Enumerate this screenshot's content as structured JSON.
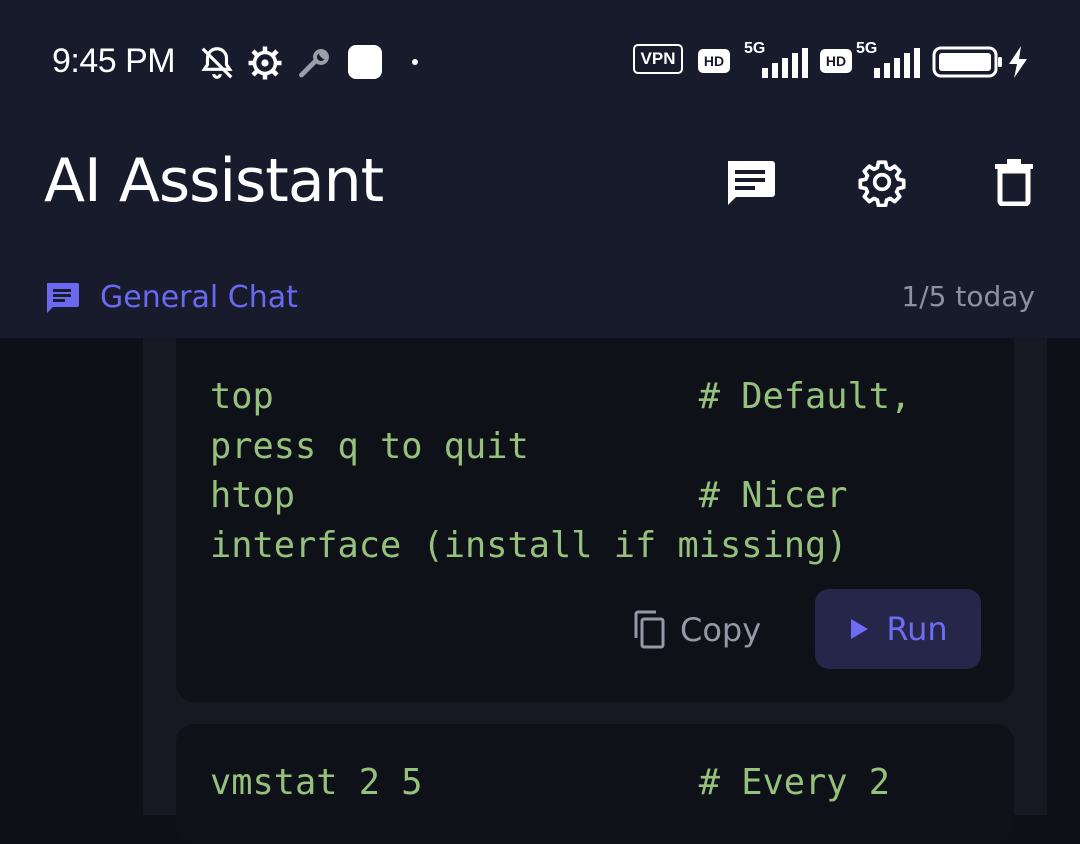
{
  "status_bar": {
    "time": "9:45 PM",
    "vpn_label": "VPN",
    "hd_label": "HD",
    "network_label": "5G",
    "icons": [
      "bell-muted-icon",
      "gear-icon",
      "wrench-icon",
      "app-square-icon",
      "dot-icon",
      "vpn-icon",
      "hd-icon",
      "signal-icon",
      "battery-icon",
      "charging-icon"
    ]
  },
  "header": {
    "title": "AI Assistant",
    "actions": [
      "chat-history-icon",
      "settings-icon",
      "delete-icon"
    ]
  },
  "chat": {
    "name": "General Chat",
    "usage": "1/5 today"
  },
  "code_blocks": [
    {
      "code": "top                    # Default,\npress q to quit\nhtop                   # Nicer\ninterface (install if missing)",
      "copy_label": "Copy",
      "run_label": "Run"
    },
    {
      "code": "vmstat 2 5             # Every 2"
    }
  ],
  "colors": {
    "header_bg": "#171b2c",
    "accent": "#6b69f0",
    "code_text": "#95c17c",
    "page_bg": "#0d1017"
  }
}
